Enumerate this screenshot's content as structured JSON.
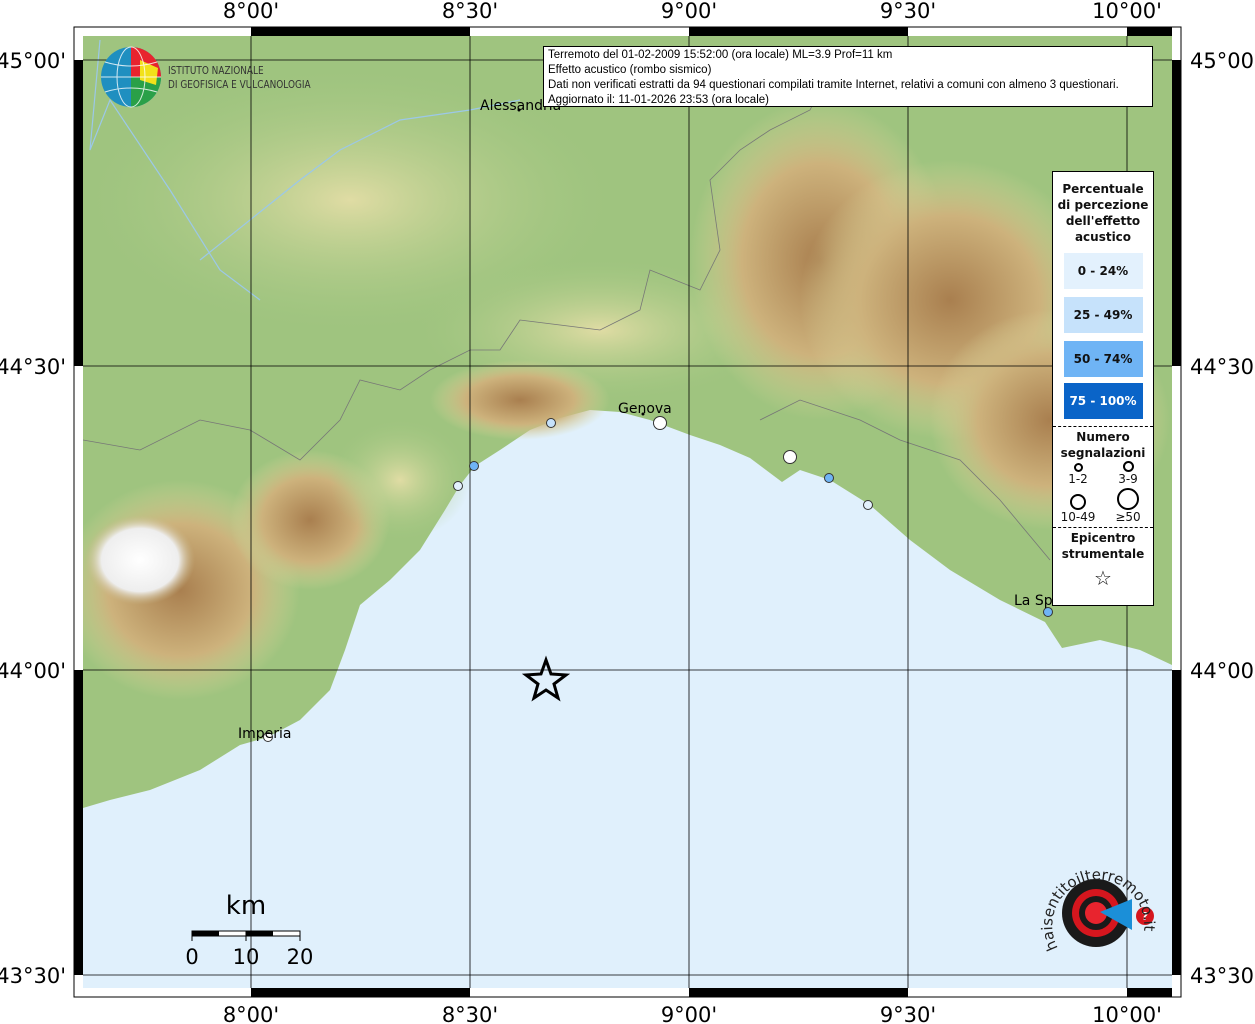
{
  "map": {
    "longitude_ticks": [
      "8°00'",
      "8°30'",
      "9°00'",
      "9°30'",
      "10°00'"
    ],
    "latitude_ticks": [
      "45°00'",
      "44°30'",
      "44°00'",
      "43°30'"
    ],
    "colors": {
      "sea": "#e0f0fc",
      "land_low": "#9fc47f",
      "land_mid": "#d9d49a",
      "land_high": "#b48a58",
      "snow": "#ffffff"
    },
    "towns": [
      {
        "name": "Alessandria"
      },
      {
        "name": "Genova"
      },
      {
        "name": "La Sp"
      },
      {
        "name": "Imperia"
      }
    ],
    "observations": [
      {
        "class": "25 - 49%",
        "count": "1-2",
        "color": "#c6e2fb"
      },
      {
        "class": "50 - 74%",
        "count": "1-2",
        "color": "#6fb4f5"
      },
      {
        "class": "0 - 24%",
        "count": "1-2",
        "color": "#e3f1fd"
      },
      {
        "class": "0 - 24%",
        "count": "3-9",
        "color": "#ffffff"
      },
      {
        "class": "0 - 24%",
        "count": "3-9",
        "color": "#ffffff"
      },
      {
        "class": "50 - 74%",
        "count": "1-2",
        "color": "#6fb4f5"
      },
      {
        "class": "0 - 24%",
        "count": "1-2",
        "color": "#e3f1fd"
      },
      {
        "class": "0 - 24%",
        "count": "1-2",
        "color": "#ffffff"
      },
      {
        "class": "50 - 74%",
        "count": "1-2",
        "color": "#6fb4f5"
      }
    ],
    "epicenter_icon": "star-icon",
    "scale": {
      "unit": "km",
      "labels": [
        "0",
        "10",
        "20"
      ]
    }
  },
  "info": {
    "line1": "Terremoto del 01-02-2009 15:52:00 (ora locale) ML=3.9 Prof=11 km",
    "line2": "Effetto acustico (rombo sismico)",
    "line3": "Dati non verificati estratti da 94 questionari compilati tramite Internet, relativi a comuni con almeno 3 questionari.",
    "line4": "Aggiornato il: 11-01-2026 23:53 (ora locale)"
  },
  "legend": {
    "title_lines": [
      "Percentuale",
      "di percezione",
      "dell'effetto",
      "acustico"
    ],
    "classes": [
      {
        "label": "0 - 24%",
        "color": "#e3f1fd",
        "text_color": "#111111"
      },
      {
        "label": "25 - 49%",
        "color": "#c6e2fb",
        "text_color": "#111111"
      },
      {
        "label": "50 - 74%",
        "color": "#6fb4f5",
        "text_color": "#111111"
      },
      {
        "label": "75 - 100%",
        "color": "#0a64c8",
        "text_color": "#ffffff"
      }
    ],
    "count_title_lines": [
      "Numero",
      "segnalazioni"
    ],
    "counts": [
      "1-2",
      "3-9",
      "10-49",
      "≥50"
    ],
    "epicenter_title_lines": [
      "Epicentro",
      "strumentale"
    ]
  },
  "logos": {
    "ingv": "ISTITUTO NAZIONALE DI GEOFISICA E VULCANOLOGIA",
    "ingv_lines": [
      "ISTITUTO NAZIONALE",
      "DI GEOFISICA E VULCANOLOGIA"
    ],
    "hsit": "www.haisentitoilterremoto.it"
  }
}
